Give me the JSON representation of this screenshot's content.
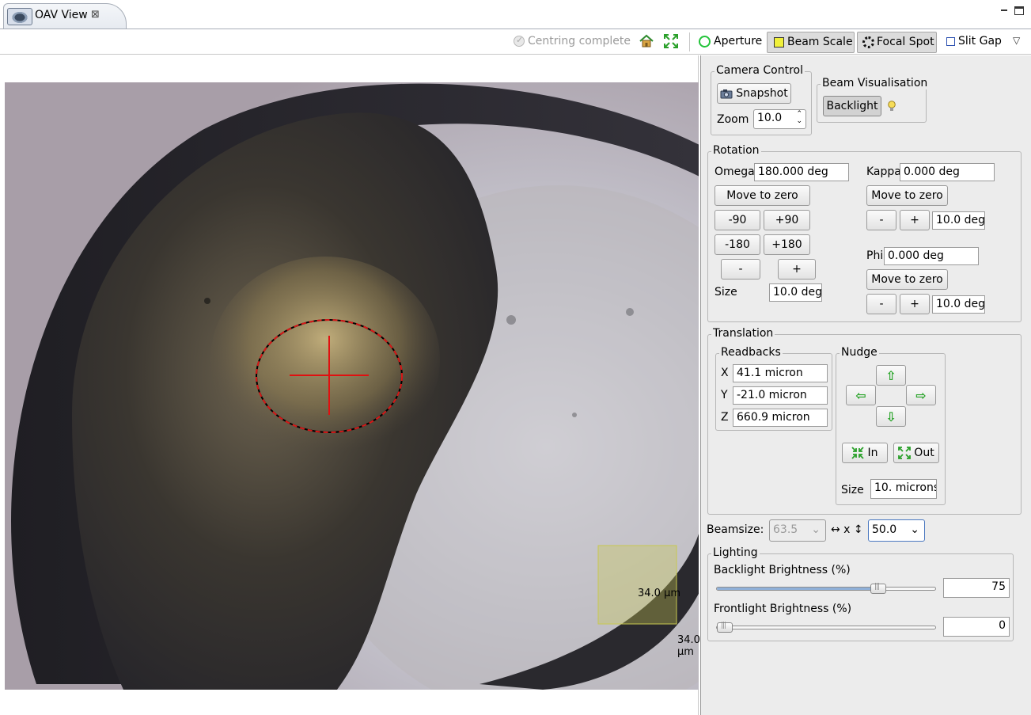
{
  "tab": {
    "title": "OAV View",
    "close_glyph": "⊠",
    "icon": "oav-view-icon"
  },
  "toolbar": {
    "centring_status": "Centring complete",
    "aperture_label": "Aperture",
    "beam_scale_label": "Beam Scale",
    "focal_spot_label": "Focal Spot",
    "slit_gap_label": "Slit Gap",
    "menu_glyph": "▽",
    "colors": {
      "aperture": "#23c43a",
      "beam_scale": "#f0f03a",
      "slit_gap": "#2a4fb0"
    }
  },
  "view": {
    "scale_x_label": "34.0 µm",
    "scale_y_label": "34.0 µm",
    "colors": {
      "beam_ellipse": "#d81818",
      "crosshair": "#e01010",
      "scale_box": "#c8c850"
    }
  },
  "camera_control": {
    "title": "Camera Control",
    "snapshot_label": "Snapshot",
    "zoom_label": "Zoom",
    "zoom_value": "10.0"
  },
  "beam_visualisation": {
    "title": "Beam Visualisation",
    "backlight_label": "Backlight"
  },
  "rotation": {
    "title": "Rotation",
    "omega_label": "Omega",
    "omega_value": "180.000 deg",
    "move_to_zero": "Move to zero",
    "minus90": "-90",
    "plus90": "+90",
    "minus180": "-180",
    "plus180": "+180",
    "minus": "-",
    "plus": "+",
    "size_label": "Size",
    "omega_step": "10.0 deg",
    "kappa_label": "Kappa",
    "kappa_value": "0.000 deg",
    "kappa_step": "10.0 deg",
    "phi_label": "Phi",
    "phi_value": "0.000 deg",
    "phi_step": "10.0 deg"
  },
  "translation": {
    "title": "Translation",
    "readbacks_title": "Readbacks",
    "x_label": "X",
    "x_value": "41.1 micron",
    "y_label": "Y",
    "y_value": "-21.0 micron",
    "z_label": "Z",
    "z_value": "660.9 micron",
    "nudge_title": "Nudge",
    "up_glyph": "⇧",
    "down_glyph": "⇩",
    "left_glyph": "⇦",
    "right_glyph": "⇨",
    "in_label": "In",
    "out_label": "Out",
    "size_label": "Size",
    "size_value": "10. microns"
  },
  "beamsize": {
    "label": "Beamsize:",
    "h_value": "63.5",
    "sep": "↔ x ↕",
    "v_value": "50.0"
  },
  "lighting": {
    "title": "Lighting",
    "backlight_label": "Backlight Brightness (%)",
    "backlight_value": "75",
    "backlight_level": 0.75,
    "frontlight_label": "Frontlight Brightness (%)",
    "frontlight_value": "0",
    "frontlight_level": 0.0
  }
}
